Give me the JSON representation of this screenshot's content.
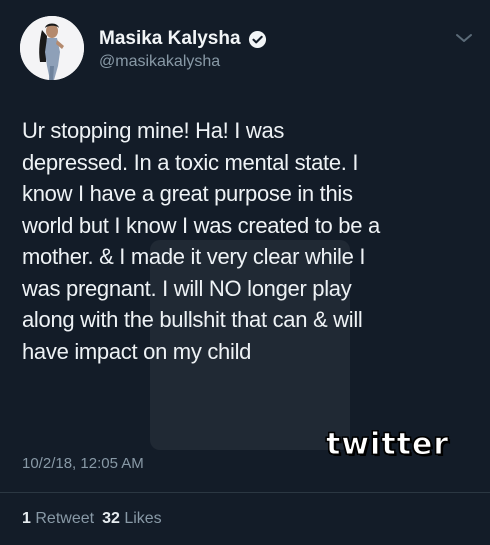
{
  "author": {
    "display_name": "Masika Kalysha",
    "handle": "@masikakalysha",
    "verified_icon": "verified-badge-icon"
  },
  "tweet": {
    "lines": [
      "Ur stopping mine! Ha! I was",
      "depressed. In a toxic mental state. I",
      "know I have a great purpose in this",
      "world but I know I was created to be a",
      "mother. & I made it very clear while I",
      "was pregnant. I will NO longer play",
      "along with the bullshit that can & will",
      "have impact on my child"
    ],
    "timestamp": "10/2/18, 12:05 AM"
  },
  "stats": {
    "retweets_count": "1",
    "retweets_label": "Retweet",
    "likes_count": "32",
    "likes_label": "Likes"
  },
  "overlay": {
    "stamp_text": "twitter"
  },
  "colors": {
    "background": "#131c28",
    "text": "#eef2f5",
    "muted": "#8899a6"
  }
}
